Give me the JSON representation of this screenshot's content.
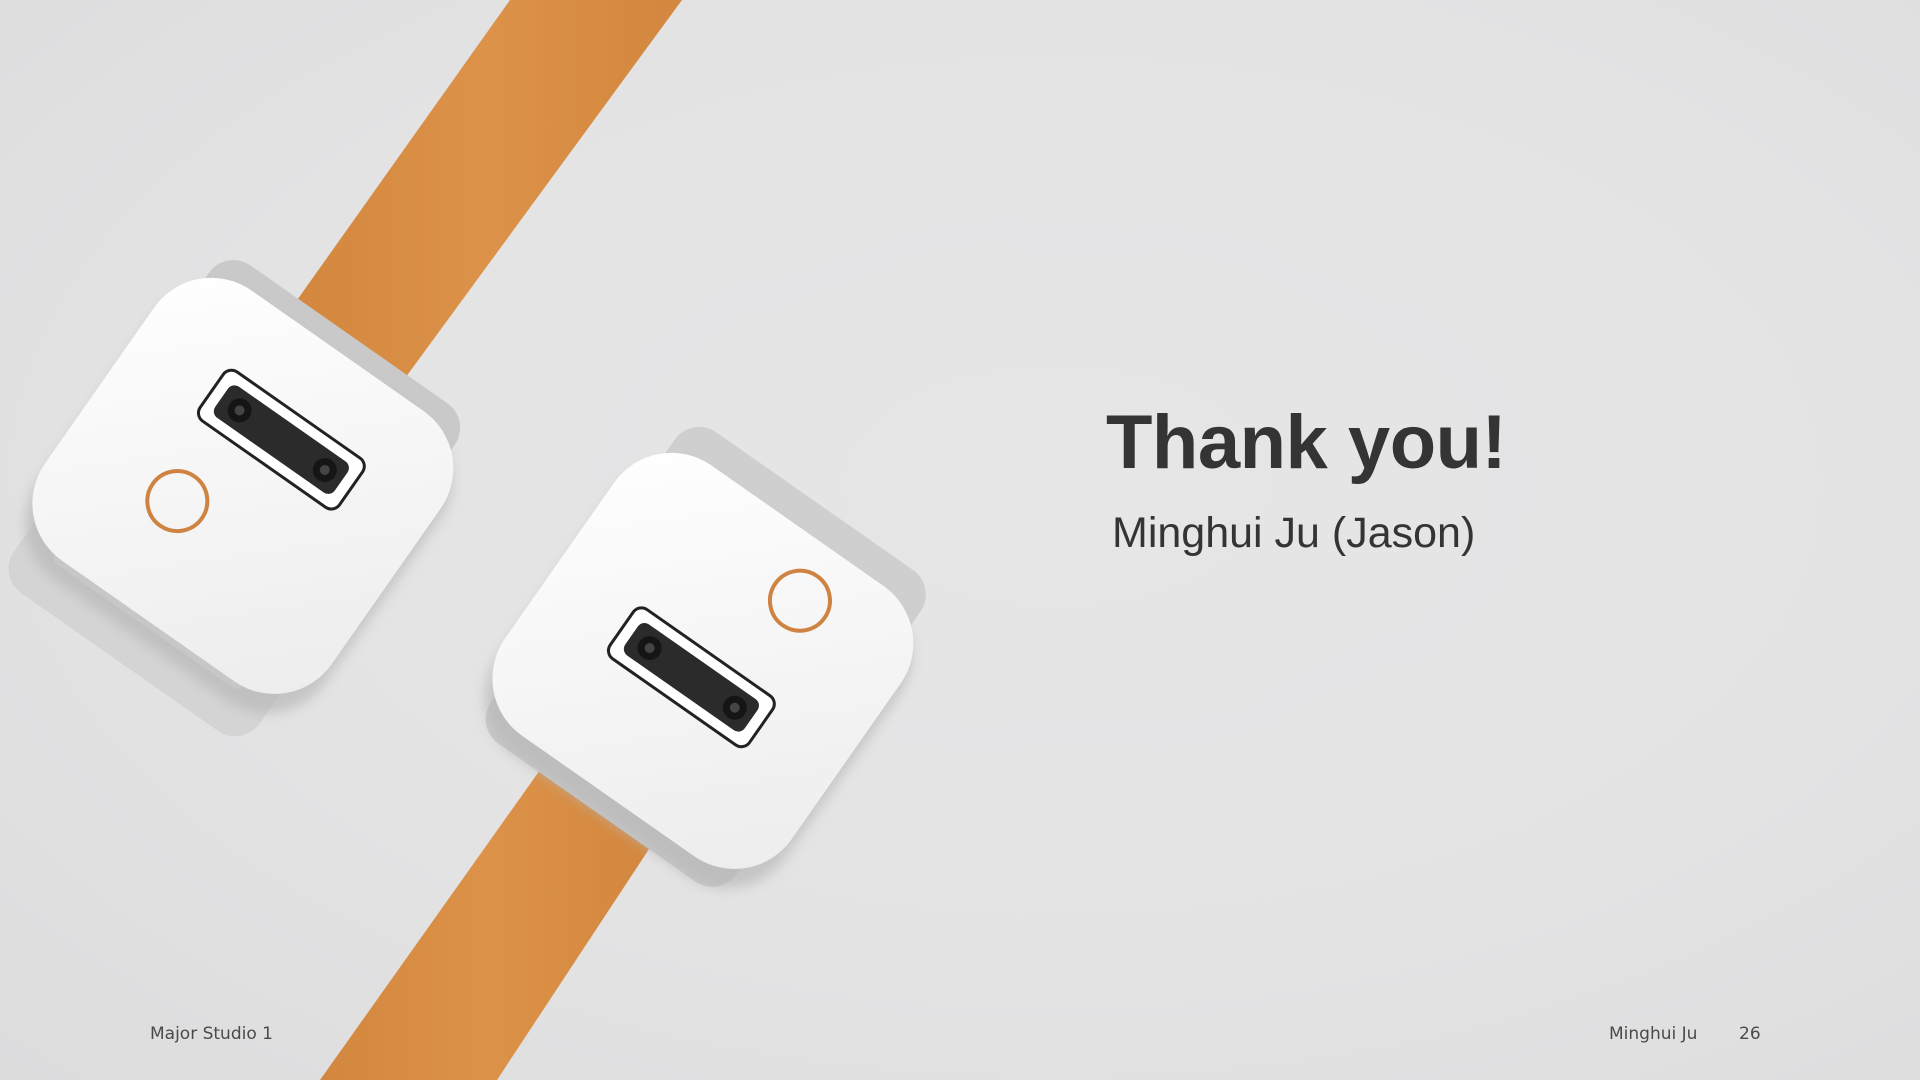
{
  "slide": {
    "title": "Thank you!",
    "subtitle": "Minghui Ju (Jason)",
    "footer": {
      "course": "Major Studio 1",
      "author": "Minghui Ju",
      "page_number": "26"
    }
  },
  "colors": {
    "background": "#e4e4e5",
    "strap": "#d98e43",
    "device_body": "#f4f4f4",
    "ring": "#cf8342",
    "text": "#343434"
  },
  "icons": [
    "wearable-device-illustration",
    "camera-lens-icon",
    "ring-button-icon"
  ]
}
